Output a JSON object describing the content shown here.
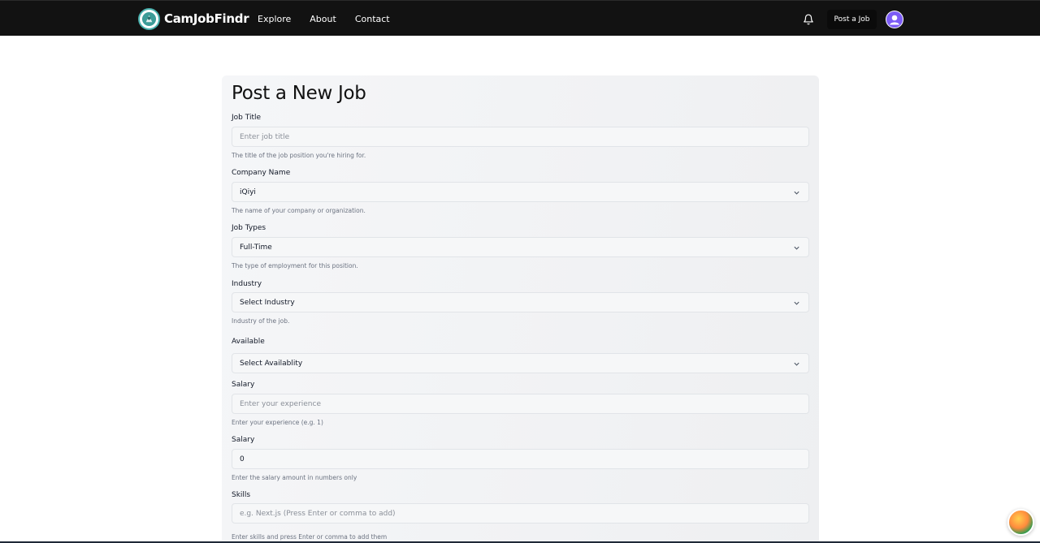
{
  "navbar": {
    "brand": "CamJobFindr",
    "links": [
      "Explore",
      "About",
      "Contact"
    ],
    "post_job_label": "Post a Job"
  },
  "form": {
    "title": "Post a New Job",
    "fields": {
      "job_title": {
        "label": "Job Title",
        "placeholder": "Enter job title",
        "value": "",
        "help": "The title of the job position you're hiring for."
      },
      "company_name": {
        "label": "Company Name",
        "value": "iQiyi",
        "help": "The name of your company or organization."
      },
      "job_types": {
        "label": "Job Types",
        "value": "Full-Time",
        "help": "The type of employment for this position."
      },
      "industry": {
        "label": "Industry",
        "value": "Select Industry",
        "help": "Industry of the job."
      },
      "available": {
        "label": "Available",
        "value": "Select Availablity"
      },
      "experience": {
        "label": "Salary",
        "placeholder": "Enter your experience",
        "value": "",
        "help": "Enter your experience (e.g. 1)"
      },
      "salary": {
        "label": "Salary",
        "value": "0",
        "help": "Enter the salary amount in numbers only"
      },
      "skills": {
        "label": "Skills",
        "placeholder": "e.g. Next.js (Press Enter or comma to add)",
        "value": "",
        "help": "Enter skills and press Enter or comma to add them"
      }
    }
  },
  "icons": {
    "bell": "bell-icon",
    "chevron": "chevron-down-icon",
    "avatar": "user-avatar-icon"
  },
  "colors": {
    "navbar_bg": "#121212",
    "avatar_accent": "#7c5cf6",
    "logo_accent": "#49b0ad"
  }
}
